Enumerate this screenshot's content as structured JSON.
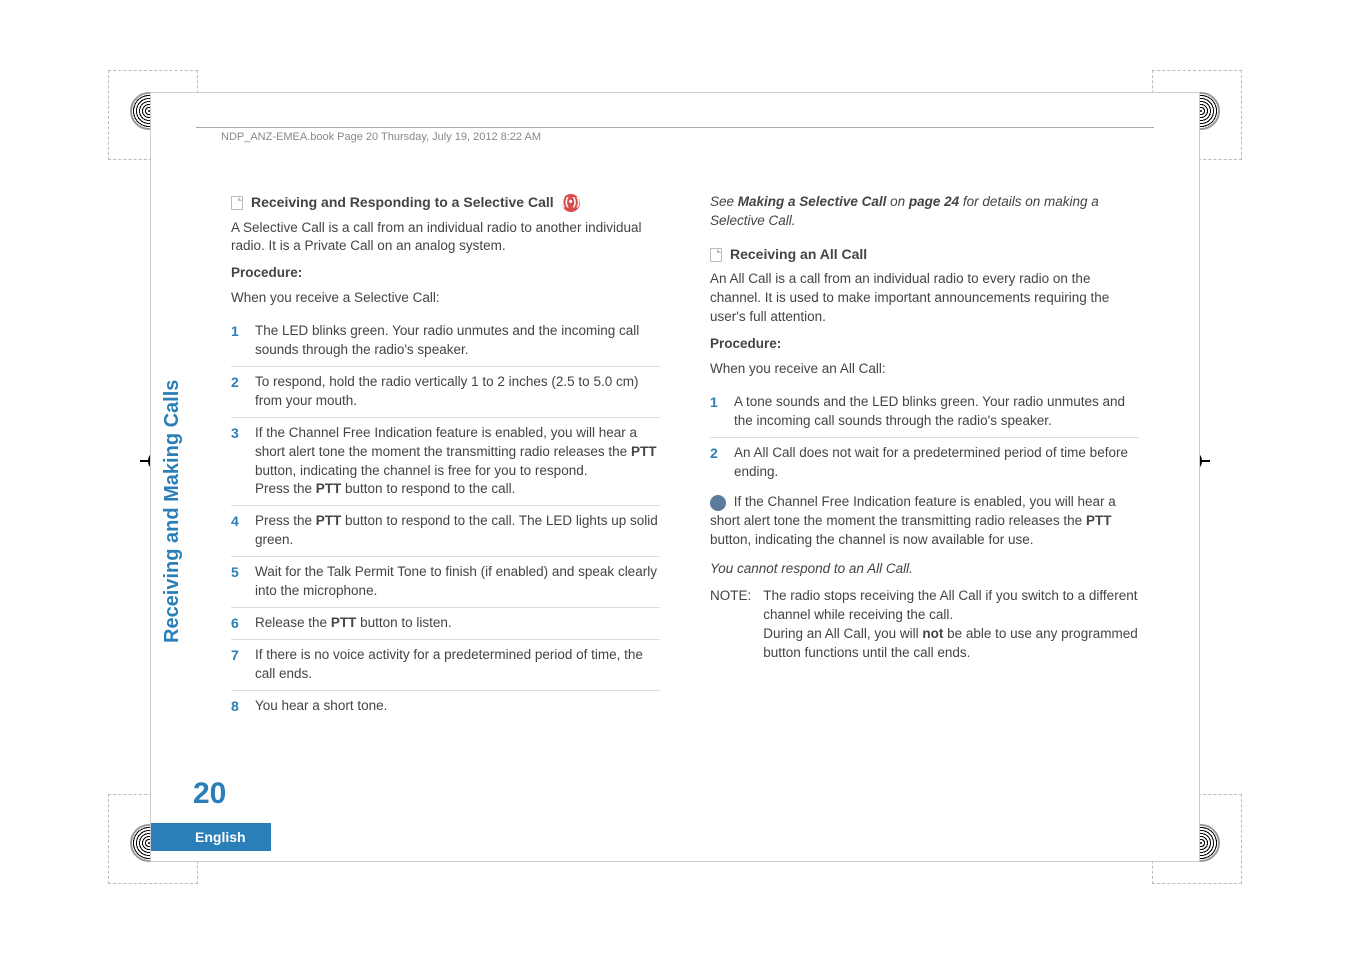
{
  "header": "NDP_ANZ-EMEA.book  Page 20  Thursday, July 19, 2012  8:22 AM",
  "sidebar_label": "Receiving and Making Calls",
  "page_number": "20",
  "language": "English",
  "left": {
    "heading": "Receiving and Responding to a Selective Call",
    "intro": "A Selective Call is a call from an individual radio to another individual radio. It is a Private Call on an analog system.",
    "procedure_label": "Procedure:",
    "procedure_when": "When you receive a Selective Call:",
    "steps": [
      "The LED blinks green. Your radio unmutes and the incoming call sounds through the radio's speaker.",
      "To respond, hold the radio vertically 1 to 2 inches (2.5 to 5.0 cm) from your mouth.",
      "If the Channel Free Indication feature is enabled, you will hear a short alert tone the moment the transmitting radio releases the PTT button, indicating the channel is free for you to respond.\nPress the PTT button to respond to the call.",
      "Press the PTT button to respond to the call. The LED lights up solid green.",
      "Wait for the Talk Permit Tone to finish (if enabled) and speak clearly into the microphone.",
      "Release the PTT button to listen.",
      "If there is no voice activity for a predetermined period of time, the call ends.",
      "You hear a short tone."
    ]
  },
  "right": {
    "see_prefix": "See ",
    "see_link": "Making a Selective Call",
    "see_mid": " on ",
    "see_page": "page 24",
    "see_suffix": " for details on making a Selective Call.",
    "heading": "Receiving an All Call",
    "intro": "An All Call is a call from an individual radio to every radio on the channel. It is used to make important announcements requiring the user's full attention.",
    "procedure_label": "Procedure:",
    "procedure_when": "When you receive an All Call:",
    "steps": [
      "A tone sounds and the LED blinks green. Your radio unmutes and the incoming call sounds through the radio's speaker.",
      "An All Call does not wait for a predetermined period of time before ending."
    ],
    "info_text": "If the Channel Free Indication feature is enabled, you will hear a short alert tone the moment the transmitting radio releases the PTT button, indicating the channel is now available for use.",
    "cannot": "You cannot respond to an All Call.",
    "note_label": "NOTE:",
    "note_body_1": "The radio stops receiving the All Call if you switch to a different channel while receiving the call.",
    "note_body_2a": "During an All Call, you will ",
    "note_body_2b": "not",
    "note_body_2c": " be able to use any programmed button functions until the call ends."
  }
}
